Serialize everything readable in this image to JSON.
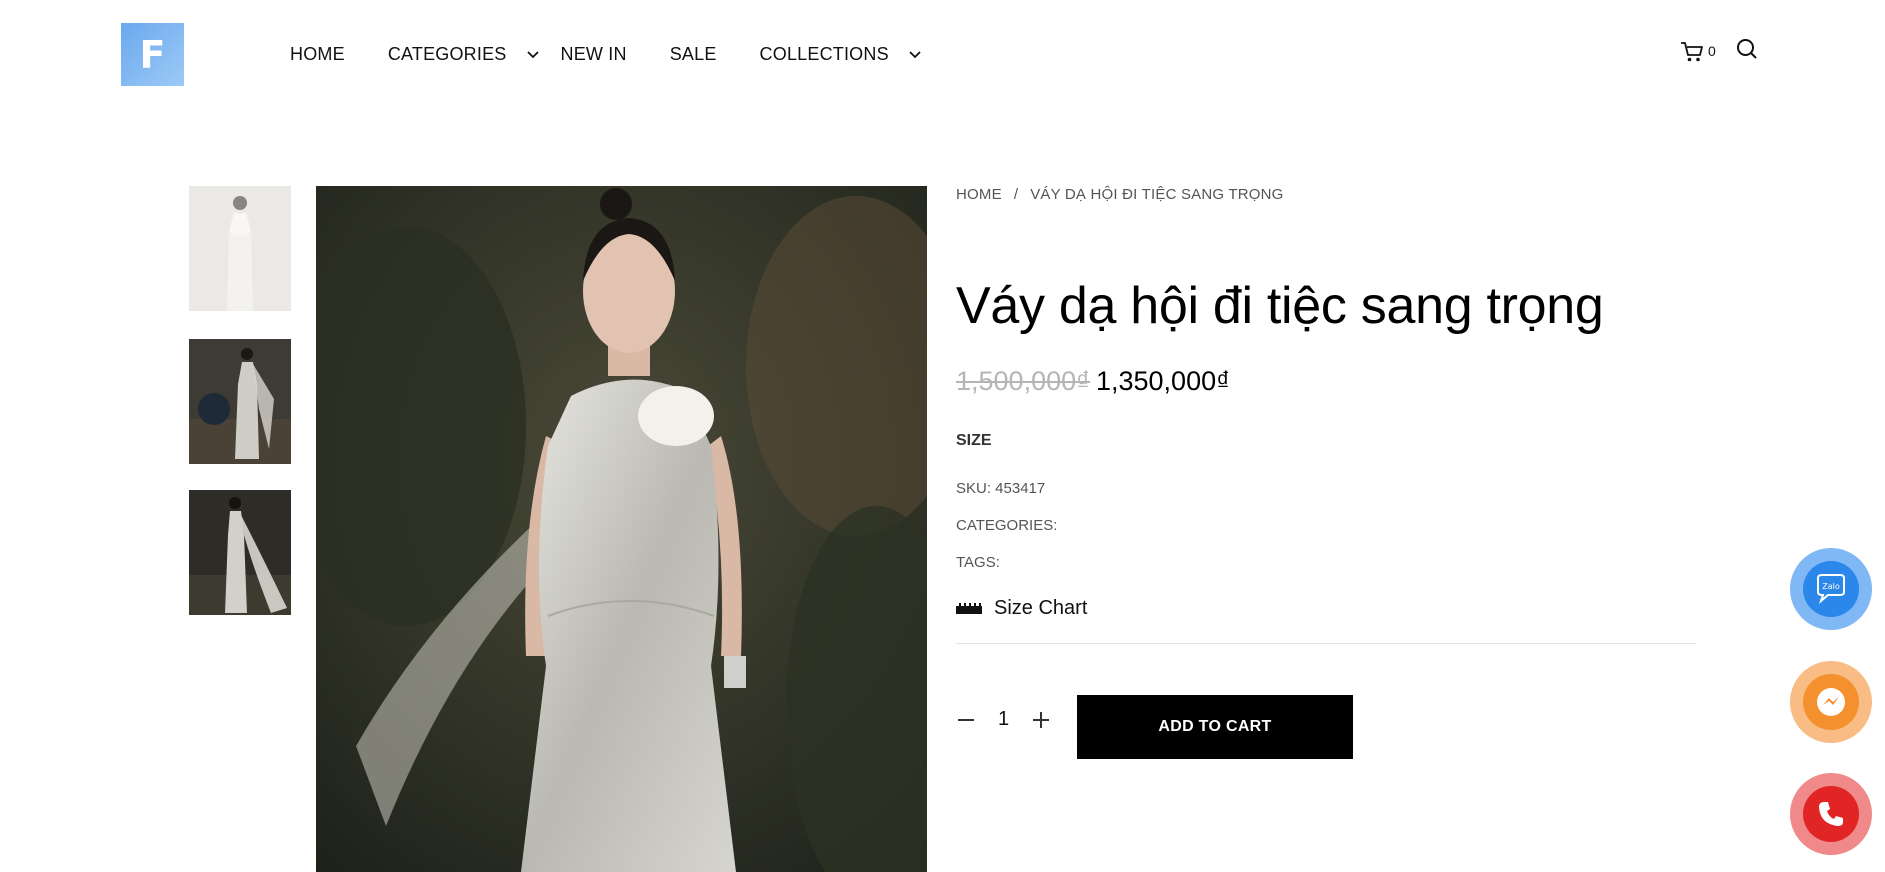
{
  "header": {
    "logo_icon": "store-logo-icon",
    "nav": [
      {
        "label": "HOME",
        "has_dropdown": false
      },
      {
        "label": "CATEGORIES",
        "has_dropdown": true
      },
      {
        "label": "NEW IN",
        "has_dropdown": false
      },
      {
        "label": "SALE",
        "has_dropdown": false
      },
      {
        "label": "COLLECTIONS",
        "has_dropdown": true
      }
    ],
    "cart_count": "0"
  },
  "breadcrumb": {
    "home": "HOME",
    "separator": "/",
    "current": "VÁY DẠ HỘI ĐI TIỆC SANG TRỌNG"
  },
  "product": {
    "title": "Váy dạ hội đi tiệc sang trọng",
    "price_old": "1,500,000₫",
    "price_new": "1,350,000₫",
    "size_label": "SIZE",
    "sku": "SKU: 453417",
    "categories": "CATEGORIES:",
    "tags": "TAGS:",
    "size_chart": "Size Chart",
    "quantity": "1",
    "add_to_cart": "ADD TO CART"
  },
  "contact_buttons": [
    {
      "name": "zalo-icon",
      "label": "Zalo",
      "color": "#2b87ea"
    },
    {
      "name": "messenger-icon",
      "color": "#f5902f"
    },
    {
      "name": "phone-icon",
      "color": "#e12424"
    }
  ],
  "colors": {
    "accent_black": "#000000",
    "price_old": "#b5b5b5"
  }
}
